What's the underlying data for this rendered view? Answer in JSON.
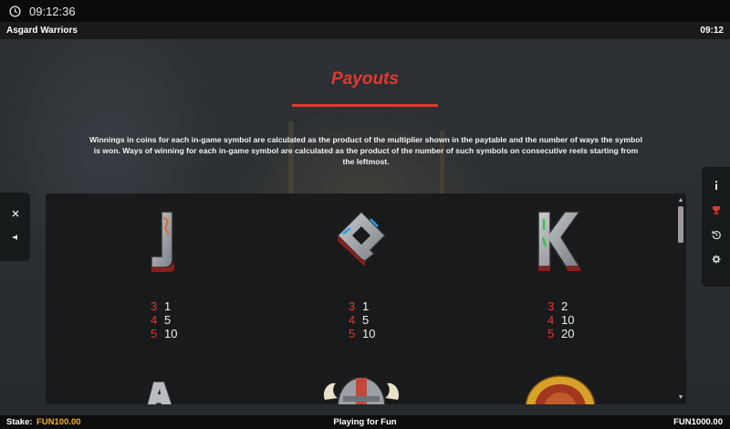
{
  "status_bar": {
    "time": "09:12:36"
  },
  "titlebar": {
    "game_title": "Asgard Warriors",
    "clock": "09:12"
  },
  "payouts": {
    "title": "Payouts",
    "description": "Winnings in coins for each in-game symbol are calculated as the product of the multiplier shown in the paytable and the number of ways the symbol is won. Ways of winning for each in-game symbol are calculated as the product of the number of such symbols on consecutive reels starting from the leftmost."
  },
  "symbols": [
    {
      "name": "J",
      "icon": "letter-j-symbol",
      "accent": "#e06b2a",
      "pays": [
        {
          "count": "3",
          "mult": "1"
        },
        {
          "count": "4",
          "mult": "5"
        },
        {
          "count": "5",
          "mult": "10"
        }
      ]
    },
    {
      "name": "Q",
      "icon": "letter-q-symbol",
      "accent": "#2aa0e0",
      "pays": [
        {
          "count": "3",
          "mult": "1"
        },
        {
          "count": "4",
          "mult": "5"
        },
        {
          "count": "5",
          "mult": "10"
        }
      ]
    },
    {
      "name": "K",
      "icon": "letter-k-symbol",
      "accent": "#3bc24a",
      "pays": [
        {
          "count": "3",
          "mult": "2"
        },
        {
          "count": "4",
          "mult": "10"
        },
        {
          "count": "5",
          "mult": "20"
        }
      ]
    }
  ],
  "next_row_symbols": [
    "letter-a-symbol",
    "viking-helmet-symbol",
    "golden-shield-symbol"
  ],
  "side_controls_left": [
    "close-icon",
    "sound-icon"
  ],
  "side_controls_right": [
    "info-icon",
    "paytable-icon",
    "history-icon",
    "settings-icon"
  ],
  "footer": {
    "stake_label": "Stake:",
    "stake_value": "FUN100.00",
    "mode": "Playing for Fun",
    "balance": "FUN1000.00"
  },
  "colors": {
    "accent_red": "#e3382e",
    "stake_gold": "#f2b21b"
  }
}
